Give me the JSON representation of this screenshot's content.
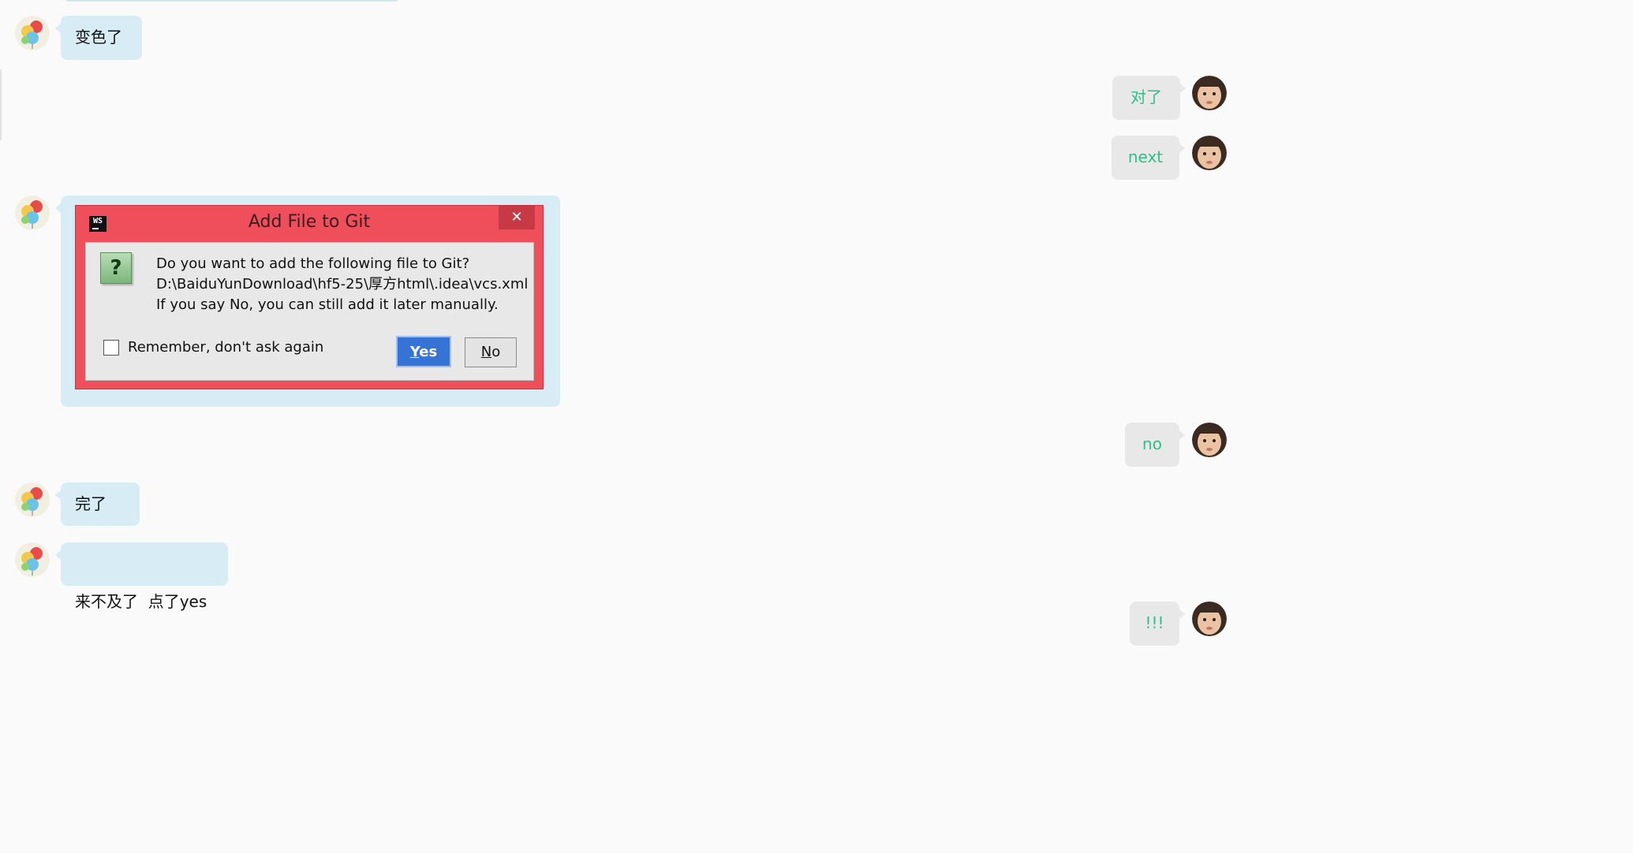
{
  "chat": {
    "messages": [
      {
        "side": "left",
        "text": "变色了"
      },
      {
        "side": "right",
        "text": "对了"
      },
      {
        "side": "right",
        "text": "next"
      },
      {
        "side": "left",
        "kind": "image-dialog"
      },
      {
        "side": "right",
        "text": "no"
      },
      {
        "side": "left",
        "text": "完了"
      },
      {
        "side": "left",
        "text": "来不及了  点了yes"
      },
      {
        "side": "right",
        "text": "!!!"
      }
    ]
  },
  "dialog": {
    "app_icon": "WS",
    "title": "Add File to Git",
    "close_glyph": "✕",
    "question_glyph": "?",
    "message_line1": "Do you want to add the following file to Git?",
    "message_line2": "D:\\BaiduYunDownload\\hf5-25\\厚方html\\.idea\\vcs.xml",
    "message_line3": "If you say No, you can still add it later manually.",
    "checkbox_label": "Remember, don't ask again",
    "checkbox_checked": false,
    "yes_mnemonic": "Y",
    "yes_rest": "es",
    "no_mnemonic": "N",
    "no_rest": "o"
  },
  "colors": {
    "left_bubble": "#d7ecf4",
    "right_bubble": "#e8e8e8",
    "right_text": "#2ec08a",
    "dialog_frame": "#ee4f5b",
    "yes_button": "#3573d4"
  },
  "icons": {
    "left_avatar": "balloons-avatar",
    "right_avatar": "baby-photo-avatar"
  }
}
